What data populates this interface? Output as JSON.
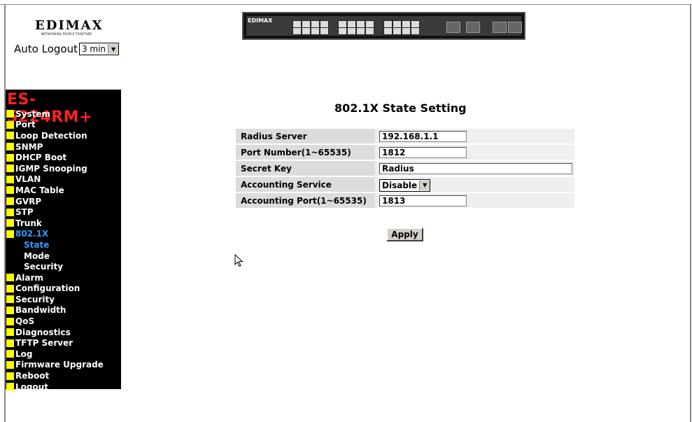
{
  "header": {
    "logo_brand": "EDIMAX",
    "logo_tagline": "NETWORKING PEOPLE TOGETHER",
    "auto_logout_label": "Auto Logout",
    "auto_logout_value": "3 min",
    "switch_logo": "EDIMAX"
  },
  "sidebar": {
    "model": "ES-5224RM+",
    "items": [
      {
        "label": "System"
      },
      {
        "label": "Port"
      },
      {
        "label": "Loop Detection"
      },
      {
        "label": "SNMP"
      },
      {
        "label": "DHCP Boot"
      },
      {
        "label": "IGMP Snooping"
      },
      {
        "label": "VLAN"
      },
      {
        "label": "MAC Table"
      },
      {
        "label": "GVRP"
      },
      {
        "label": "STP"
      },
      {
        "label": "Trunk"
      },
      {
        "label": "802.1X"
      },
      {
        "label": "State"
      },
      {
        "label": "Mode"
      },
      {
        "label": "Security"
      },
      {
        "label": "Alarm"
      },
      {
        "label": "Configuration"
      },
      {
        "label": "Security"
      },
      {
        "label": "Bandwidth"
      },
      {
        "label": "QoS"
      },
      {
        "label": "Diagnostics"
      },
      {
        "label": "TFTP Server"
      },
      {
        "label": "Log"
      },
      {
        "label": "Firmware Upgrade"
      },
      {
        "label": "Reboot"
      },
      {
        "label": "Logout"
      }
    ]
  },
  "main": {
    "title": "802.1X State Setting",
    "rows": [
      {
        "label": "Radius Server",
        "value": "192.168.1.1"
      },
      {
        "label": "Port Number(1~65535)",
        "value": "1812"
      },
      {
        "label": "Secret Key",
        "value": "Radius"
      },
      {
        "label": "Accounting Service",
        "value": "Disable"
      },
      {
        "label": "Accounting Port(1~65535)",
        "value": "1813"
      }
    ],
    "apply_label": "Apply"
  }
}
